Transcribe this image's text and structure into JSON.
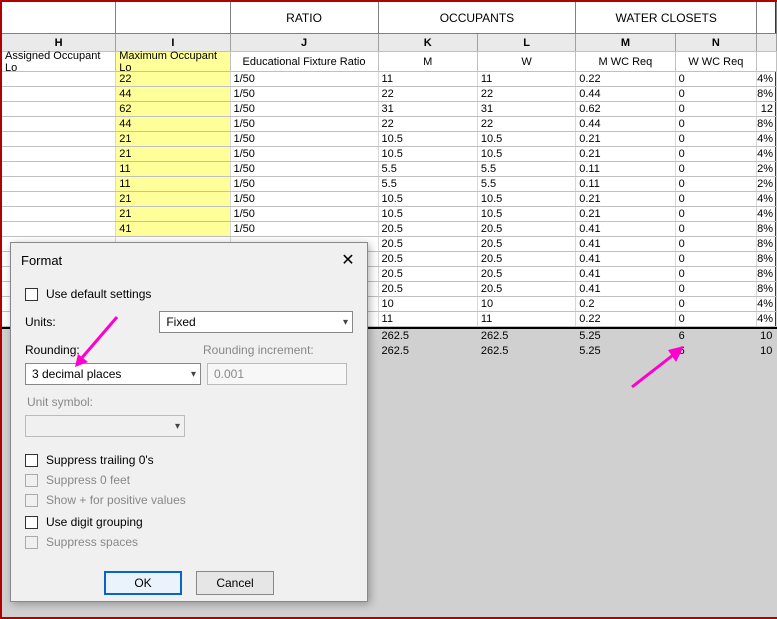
{
  "group_headers": {
    "ratio": "RATIO",
    "occupants": "OCCUPANTS",
    "wc": "WATER CLOSETS"
  },
  "letters": [
    "H",
    "I",
    "J",
    "K",
    "L",
    "M",
    "N"
  ],
  "headers": {
    "H": "Assigned Occupant Lo",
    "I": "Maximum Occupant Lo",
    "J": "Educational Fixture Ratio",
    "K": "M",
    "L": "W",
    "M": "M WC Req",
    "N": "W WC Req"
  },
  "rows": [
    {
      "I": "22",
      "J": "1/50",
      "K": "11",
      "L": "11",
      "M": "0.22",
      "N": "0",
      "O": "4%"
    },
    {
      "I": "44",
      "J": "1/50",
      "K": "22",
      "L": "22",
      "M": "0.44",
      "N": "0",
      "O": "8%"
    },
    {
      "I": "62",
      "J": "1/50",
      "K": "31",
      "L": "31",
      "M": "0.62",
      "N": "0",
      "O": "12"
    },
    {
      "I": "44",
      "J": "1/50",
      "K": "22",
      "L": "22",
      "M": "0.44",
      "N": "0",
      "O": "8%"
    },
    {
      "I": "21",
      "J": "1/50",
      "K": "10.5",
      "L": "10.5",
      "M": "0.21",
      "N": "0",
      "O": "4%"
    },
    {
      "I": "21",
      "J": "1/50",
      "K": "10.5",
      "L": "10.5",
      "M": "0.21",
      "N": "0",
      "O": "4%"
    },
    {
      "I": "11",
      "J": "1/50",
      "K": "5.5",
      "L": "5.5",
      "M": "0.11",
      "N": "0",
      "O": "2%"
    },
    {
      "I": "11",
      "J": "1/50",
      "K": "5.5",
      "L": "5.5",
      "M": "0.11",
      "N": "0",
      "O": "2%"
    },
    {
      "I": "21",
      "J": "1/50",
      "K": "10.5",
      "L": "10.5",
      "M": "0.21",
      "N": "0",
      "O": "4%"
    },
    {
      "I": "21",
      "J": "1/50",
      "K": "10.5",
      "L": "10.5",
      "M": "0.21",
      "N": "0",
      "O": "4%"
    },
    {
      "I": "41",
      "J": "1/50",
      "K": "20.5",
      "L": "20.5",
      "M": "0.41",
      "N": "0",
      "O": "8%"
    },
    {
      "I": "",
      "J": "",
      "K": "20.5",
      "L": "20.5",
      "M": "0.41",
      "N": "0",
      "O": "8%"
    },
    {
      "I": "",
      "J": "",
      "K": "20.5",
      "L": "20.5",
      "M": "0.41",
      "N": "0",
      "O": "8%"
    },
    {
      "I": "",
      "J": "",
      "K": "20.5",
      "L": "20.5",
      "M": "0.41",
      "N": "0",
      "O": "8%"
    },
    {
      "I": "",
      "J": "",
      "K": "20.5",
      "L": "20.5",
      "M": "0.41",
      "N": "0",
      "O": "8%"
    },
    {
      "I": "",
      "J": "",
      "K": "10",
      "L": "10",
      "M": "0.2",
      "N": "0",
      "O": "4%"
    },
    {
      "I": "",
      "J": "",
      "K": "11",
      "L": "11",
      "M": "0.22",
      "N": "0",
      "O": "4%"
    }
  ],
  "totals": [
    {
      "K": "262.5",
      "L": "262.5",
      "M": "5.25",
      "N": "6",
      "O": "10"
    },
    {
      "K": "262.5",
      "L": "262.5",
      "M": "5.25",
      "N": "6",
      "O": "10"
    }
  ],
  "dialog": {
    "title": "Format",
    "use_default": "Use default settings",
    "units_lbl": "Units:",
    "units_val": "Fixed",
    "rounding_lbl": "Rounding:",
    "rounding_inc_lbl": "Rounding increment:",
    "rounding_val": "3 decimal places",
    "rounding_inc_val": "0.001",
    "unit_symbol_lbl": "Unit symbol:",
    "suppress_trailing": "Suppress trailing 0's",
    "suppress_feet": "Suppress 0 feet",
    "show_plus": "Show + for positive values",
    "digit_grouping": "Use digit grouping",
    "suppress_spaces": "Suppress spaces",
    "ok": "OK",
    "cancel": "Cancel"
  }
}
